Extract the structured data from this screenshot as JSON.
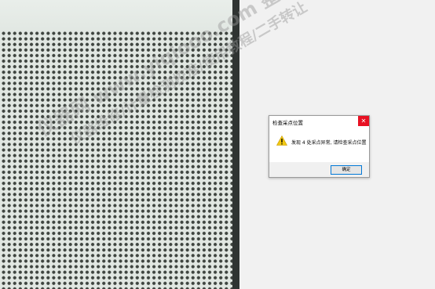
{
  "dialog": {
    "title": "检查采点位置",
    "message": "发现 4 处采点异常, 请检查采点位置",
    "ok_label": "确定",
    "close_glyph": "✕",
    "icon": "warning-icon"
  },
  "watermark": {
    "line1": "仪器网 www.yiqiooo.com 整理分享",
    "line2": "仪器维修/计量检测校准/使用教程/二手转让"
  },
  "colors": {
    "close_button": "#e81123",
    "button_focus_border": "#0078d7",
    "warning_yellow": "#f2c811",
    "divider": "#2f3432"
  }
}
